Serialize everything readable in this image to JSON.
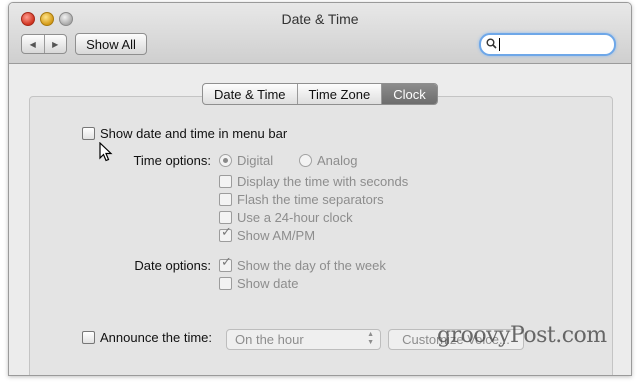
{
  "window": {
    "title": "Date & Time"
  },
  "toolbar": {
    "back_glyph": "◀",
    "forward_glyph": "▶",
    "show_all_label": "Show All",
    "search": {
      "icon": "magnifier-icon",
      "value": ""
    }
  },
  "tabs": [
    {
      "label": "Date & Time",
      "selected": false
    },
    {
      "label": "Time Zone",
      "selected": false
    },
    {
      "label": "Clock",
      "selected": true
    }
  ],
  "clock": {
    "show_in_menu_bar": {
      "label": "Show date and time in menu bar",
      "checked": false
    },
    "time_options": {
      "label": "Time options:",
      "digital": {
        "label": "Digital",
        "selected": true
      },
      "analog": {
        "label": "Analog",
        "selected": false
      },
      "display_seconds": {
        "label": "Display the time with seconds",
        "checked": false
      },
      "flash_separators": {
        "label": "Flash the time separators",
        "checked": false
      },
      "use_24_hour": {
        "label": "Use a 24-hour clock",
        "checked": false
      },
      "show_am_pm": {
        "label": "Show AM/PM",
        "checked": true
      }
    },
    "date_options": {
      "label": "Date options:",
      "show_day_of_week": {
        "label": "Show the day of the week",
        "checked": true
      },
      "show_date": {
        "label": "Show date",
        "checked": false
      }
    },
    "announce": {
      "label": "Announce the time:",
      "checked": false,
      "interval": "On the hour",
      "customize_label": "Customize Voice..."
    }
  },
  "watermark": "groovyPost.com"
}
